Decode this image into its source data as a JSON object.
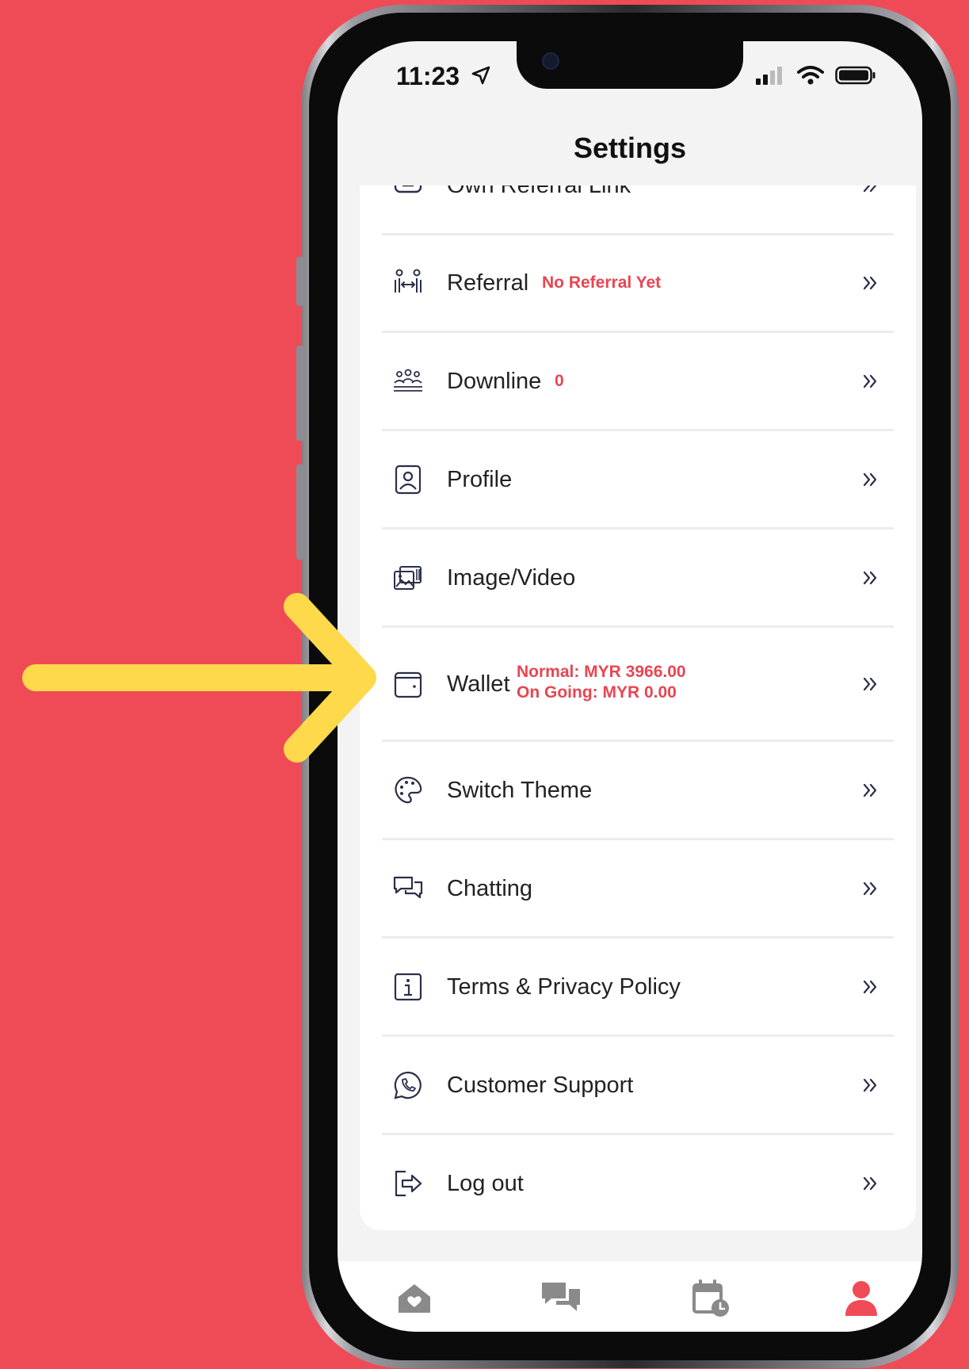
{
  "status": {
    "time": "11:23"
  },
  "header": {
    "title": "Settings"
  },
  "settings": {
    "items": [
      {
        "label": "Own Referral Link",
        "icon": "link-icon"
      },
      {
        "label": "Referral",
        "badge": "No Referral Yet",
        "icon": "referral-icon"
      },
      {
        "label": "Downline",
        "badge": "0",
        "icon": "group-icon"
      },
      {
        "label": "Profile",
        "icon": "profile-icon"
      },
      {
        "label": "Image/Video",
        "icon": "gallery-icon"
      },
      {
        "label": "Wallet",
        "badge_line1": "Normal: MYR 3966.00",
        "badge_line2": "On Going: MYR 0.00",
        "icon": "wallet-icon"
      },
      {
        "label": "Switch Theme",
        "icon": "palette-icon"
      },
      {
        "label": "Chatting",
        "icon": "chat-icon"
      },
      {
        "label": "Terms & Privacy Policy",
        "icon": "info-icon"
      },
      {
        "label": "Customer Support",
        "icon": "whatsapp-icon"
      },
      {
        "label": "Log out",
        "icon": "logout-icon"
      }
    ]
  },
  "tabbar": {
    "tabs": [
      {
        "icon": "home-heart-icon",
        "active": false
      },
      {
        "icon": "chat-bubbles-icon",
        "active": false
      },
      {
        "icon": "calendar-clock-icon",
        "active": false
      },
      {
        "icon": "user-icon",
        "active": true
      }
    ]
  },
  "colors": {
    "background": "#ef4b57",
    "accent": "#e94551",
    "highlight_arrow": "#fdd94b",
    "inactive_tab": "#8a8a8a"
  }
}
